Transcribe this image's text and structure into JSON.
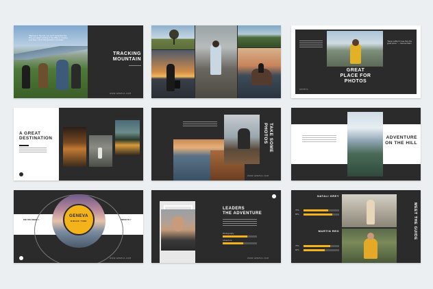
{
  "slides": {
    "s1": {
      "title": "TRACKING\nMOUNTAIN",
      "quote": "\"Because in the end, you won't remember the time you spent working in the office or mowing your lawn. Climb that goddamn mountain.\"",
      "url": "WWW.GENEVA.COM"
    },
    "s2": {},
    "s3": {
      "title": "GREAT\nPLACE FOR\nPHOTOS",
      "caption": "\"Never settle for less than the great place.\" — Geneva Team",
      "url": "GENEVA"
    },
    "s4": {
      "title": "A GREAT\nDESTINATION",
      "url": "WWW.GENEVA.COM"
    },
    "s5": {
      "title": "TAKE SOME\nPHOTOS",
      "url": "WWW.GENEVA.COM"
    },
    "s6": {
      "title": "ADVENTURE\nON THE HILL"
    },
    "s7": {
      "brand": "GENEVA",
      "tagline": "BREAK TIME",
      "left_label": "DID YOU KNOW ?",
      "right_label": "FRESH TO ?",
      "url": "WWW.GENEVA.COM"
    },
    "s8": {
      "title": "LEADERS\nTHE ADVENTURE",
      "bars": [
        {
          "label": "Photography",
          "value": 0.72
        },
        {
          "label": "Adventure",
          "value": 0.6
        }
      ],
      "url": "WWW.GENEVA.COM"
    },
    "s9": {
      "title": "MEET THE GUIDE",
      "people": [
        {
          "name": "NATALI GREY",
          "skills": [
            {
              "label": "70%",
              "value": 0.7
            },
            {
              "label": "80%",
              "value": 0.8
            }
          ]
        },
        {
          "name": "MARTIN REO",
          "skills": [
            {
              "label": "75%",
              "value": 0.75
            },
            {
              "label": "60%",
              "value": 0.6
            }
          ]
        }
      ]
    }
  },
  "colors": {
    "accent": "#f5b31b",
    "dark": "#2b2b2b",
    "light": "#ffffff",
    "background": "#eceff2"
  }
}
